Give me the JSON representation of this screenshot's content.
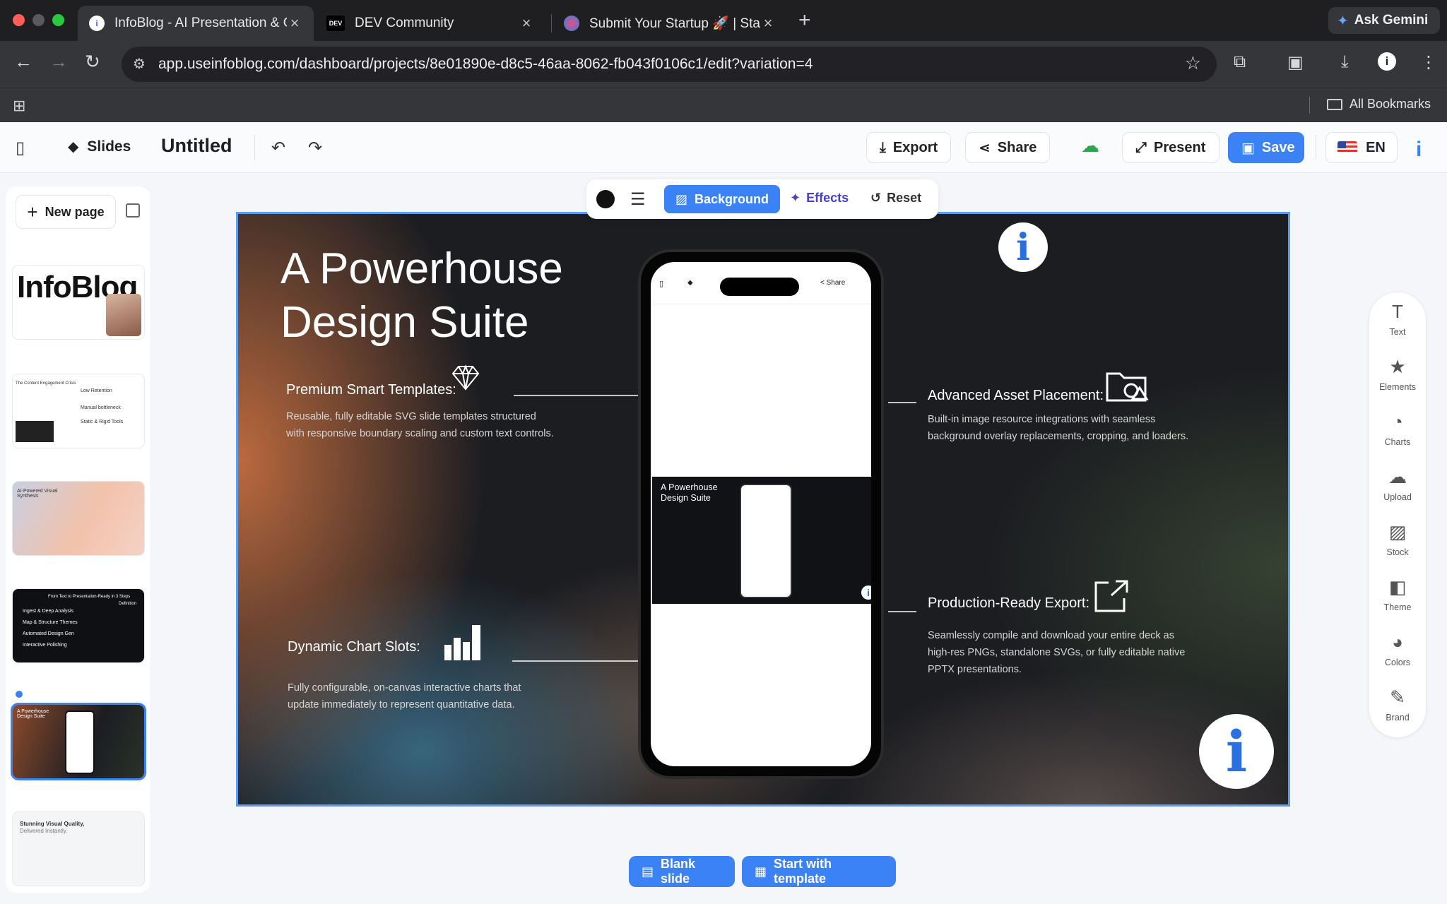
{
  "browser": {
    "tabs": [
      {
        "title": "InfoBlog - AI Presentation & C",
        "favicon": "info-icon",
        "active": true
      },
      {
        "title": "DEV Community",
        "favicon": "dev-icon",
        "active": false
      },
      {
        "title": "Submit Your Startup 🚀 | Star",
        "favicon": "startup-icon",
        "active": false
      }
    ],
    "dev_favicon_text": "DEV",
    "gemini_label": "Ask Gemini",
    "url": "app.useinfoblog.com/dashboard/projects/8e01890e-d8c5-46aa-8062-fb043f0106c1/edit?variation=4",
    "bookmarks_label": "All Bookmarks"
  },
  "header": {
    "slides_label": "Slides",
    "doc_title": "Untitled",
    "export_label": "Export",
    "share_label": "Share",
    "present_label": "Present",
    "save_label": "Save",
    "language": "EN"
  },
  "pages_panel": {
    "new_page_label": "New page",
    "thumbnails": [
      {
        "text": "InfoBlog"
      },
      {
        "text": "The Content Engagement Crisis",
        "items": [
          "Low Retention",
          "Manual bottleneck",
          "Static & Rigid Tools"
        ]
      },
      {
        "text": "AI-Powered Visual Synthesis"
      },
      {
        "text": "From Text to Presentation-Ready in 3 Steps",
        "subtitle": "Definition",
        "items": [
          "Ingest & Deep Analysis",
          "Map & Structure Themes",
          "Automated Design Gen",
          "Interactive Polishing"
        ]
      },
      {
        "text": "A Powerhouse Design Suite"
      },
      {
        "text": "Stunning Visual Quality,",
        "subtitle": "Delivered Instantly."
      }
    ]
  },
  "slide_toolbar": {
    "background_label": "Background",
    "effects_label": "Effects",
    "reset_label": "Reset"
  },
  "slide": {
    "title_line1": "A Powerhouse",
    "title_line2": "Design Suite",
    "features": [
      {
        "heading": "Premium Smart Templates:",
        "desc_line1": "Reusable, fully editable SVG slide templates structured",
        "desc_line2": "with responsive boundary scaling and custom text controls.",
        "icon": "diamond-icon"
      },
      {
        "heading": "Dynamic Chart Slots:",
        "desc_line1": "Fully configurable, on-canvas interactive charts that",
        "desc_line2": "update immediately to represent quantitative data.",
        "icon": "bar-chart-icon"
      },
      {
        "heading": "Advanced Asset Placement:",
        "desc_line1": "Built-in image resource integrations with seamless",
        "desc_line2": "background overlay replacements, cropping, and loaders.",
        "icon": "folder-shapes-icon"
      },
      {
        "heading": "Production-Ready Export:",
        "desc_line1": "Seamlessly compile and download your entire deck as",
        "desc_line2": "high-res PNGs, standalone SVGs, or fully editable native",
        "desc_line3": "PPTX presentations.",
        "icon": "external-link-icon"
      }
    ],
    "phone": {
      "share_label": "Share",
      "mini_title_line1": "A Powerhouse",
      "mini_title_line2": "Design Suite"
    }
  },
  "tool_rail": [
    {
      "label": "Text",
      "icon": "text-icon"
    },
    {
      "label": "Elements",
      "icon": "star-icon"
    },
    {
      "label": "Charts",
      "icon": "pie-chart-icon"
    },
    {
      "label": "Upload",
      "icon": "cloud-upload-icon"
    },
    {
      "label": "Stock",
      "icon": "image-icon"
    },
    {
      "label": "Theme",
      "icon": "theme-icon"
    },
    {
      "label": "Colors",
      "icon": "palette-icon"
    },
    {
      "label": "Brand",
      "icon": "brush-icon"
    }
  ],
  "bottom": {
    "blank_label": "Blank slide",
    "template_label": "Start with template"
  },
  "colors": {
    "accent": "#3b82f6",
    "effects": "#4a3fc8",
    "upload_cloud": "#2ea44f"
  }
}
